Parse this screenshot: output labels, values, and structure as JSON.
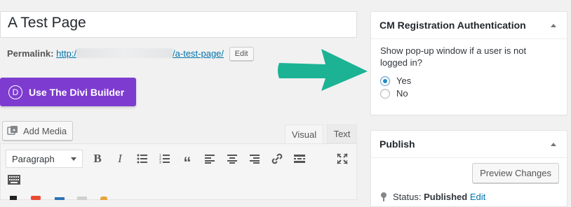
{
  "post": {
    "title": "A Test Page",
    "permalink_label": "Permalink:",
    "permalink_prefix": "http:/",
    "permalink_slug": "/a-test-page/",
    "permalink_edit": "Edit"
  },
  "divi": {
    "button_label": "Use The Divi Builder",
    "logo_letter": "D",
    "color": "#7e3bd0"
  },
  "editor": {
    "add_media_label": "Add Media",
    "tab_visual": "Visual",
    "tab_text": "Text",
    "format_value": "Paragraph",
    "toolbar_icons": [
      "bold-icon",
      "italic-icon",
      "bullet-list-icon",
      "numbered-list-icon",
      "blockquote-icon",
      "align-left-icon",
      "align-center-icon",
      "align-right-icon",
      "link-icon",
      "read-more-icon",
      "fullscreen-icon",
      "keyboard-icon"
    ]
  },
  "cm_panel": {
    "title": "CM Registration Authentication",
    "question": "Show pop-up window if a user is not logged in?",
    "options": [
      {
        "label": "Yes",
        "checked": true
      },
      {
        "label": "No",
        "checked": false
      }
    ]
  },
  "publish_panel": {
    "title": "Publish",
    "preview_label": "Preview Changes",
    "status_label": "Status:",
    "status_value": "Published",
    "status_edit": "Edit"
  },
  "colors": {
    "accent_link": "#0073aa",
    "arrow": "#1bb394"
  }
}
